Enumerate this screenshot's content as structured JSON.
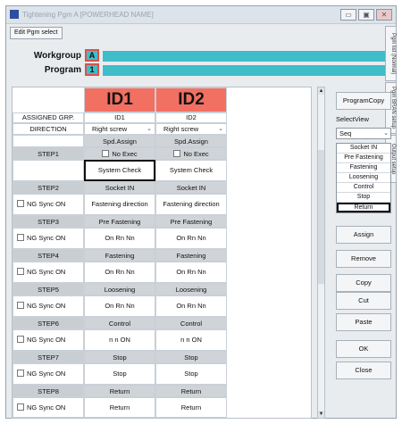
{
  "window": {
    "title": "Tightening Pgm A [POWERHEAD NAME]",
    "buttons": {
      "minimize": "▭",
      "maximize": "▣",
      "close": "✕"
    }
  },
  "toolbar": {
    "edit_pgm_select": "Edit Pgm select"
  },
  "header": {
    "workgroup_label": "Workgroup",
    "workgroup_value": "A",
    "program_label": "Program",
    "program_value": "1"
  },
  "side_tabs": [
    "Pgm list (Normal)",
    "Pgm BRAN setup",
    "Output setup"
  ],
  "grid": {
    "columns": [
      "ID1",
      "ID2"
    ],
    "assigned_grp_label": "ASSIGNED GRP.",
    "assigned_grp": [
      "ID1",
      "ID2"
    ],
    "direction_label": "DIRECTION",
    "direction": [
      "Right screw",
      "Right screw"
    ],
    "spd_assign": [
      "Spd.Assign",
      "Spd.Assign"
    ],
    "step1_label": "STEP1",
    "no_exec": [
      "No Exec",
      "No Exec"
    ],
    "system_check": [
      "System Check",
      "System Check"
    ],
    "step2_label": "STEP2",
    "socket_in": [
      "Socket IN",
      "Socket IN"
    ],
    "ng_sync_on": "NG Sync ON",
    "rows": [
      {
        "step": "STEP3",
        "header": [
          "Pre Fastening",
          "Pre Fastening"
        ],
        "body_first": [
          "Fastening direction",
          "Fastening direction"
        ],
        "body": [
          "On Rn Nn",
          "On Rn Nn"
        ]
      },
      {
        "step": "STEP4",
        "header": [
          "Fastening",
          "Fastening"
        ],
        "body": [
          "On Rn Nn",
          "On Rn Nn"
        ]
      },
      {
        "step": "STEP5",
        "header": [
          "Loosening",
          "Loosening"
        ],
        "body": [
          "On Rn Nn",
          "On Rn Nn"
        ]
      },
      {
        "step": "STEP6",
        "header": [
          "Control",
          "Control"
        ],
        "body": [
          "n n ON",
          "n n ON"
        ]
      },
      {
        "step": "STEP7",
        "header": [
          "Stop",
          "Stop"
        ],
        "body": [
          "Stop",
          "Stop"
        ]
      },
      {
        "step": "STEP8",
        "header": [
          "Return",
          "Return"
        ],
        "body": [
          "Return",
          "Return"
        ]
      }
    ]
  },
  "right_panel": {
    "program_copy": "ProgramCopy",
    "select_view_label": "SelectView",
    "select_view_value": "Seq",
    "view_items": [
      "Socket IN",
      "Pre Fastening",
      "Fastening",
      "Loosening",
      "Control",
      "Stop",
      "Return"
    ],
    "view_active_index": 6,
    "buttons": [
      "Assign",
      "Remove",
      "Copy",
      "Cut",
      "Paste",
      "OK",
      "Close"
    ]
  }
}
